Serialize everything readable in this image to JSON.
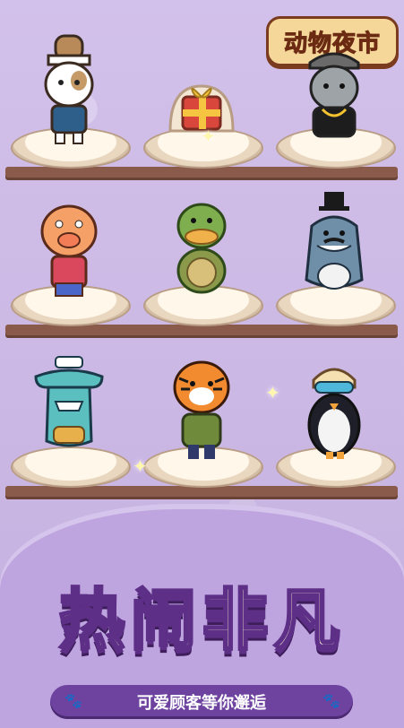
{
  "logo": {
    "text": "动物夜市"
  },
  "banner": {
    "title": "热闹非凡",
    "subtitle": "可爱顾客等你邂逅"
  },
  "icons": {
    "paw_left": "paw-icon",
    "paw_right": "paw-icon",
    "sparkle": "sparkle-icon"
  },
  "colors": {
    "background": "#c9b6e0",
    "shelf": "#8a5a4a",
    "title_fill": "#fff6d6",
    "title_outline": "#5d2f86",
    "subtitle_bar": "#6e43a0"
  },
  "characters": [
    {
      "name": "chef-dog",
      "row": 1,
      "col": 1
    },
    {
      "name": "gift-box",
      "row": 1,
      "col": 2
    },
    {
      "name": "gangster-seal",
      "row": 1,
      "col": 3
    },
    {
      "name": "pig",
      "row": 2,
      "col": 1
    },
    {
      "name": "turtle-duck",
      "row": 2,
      "col": 2
    },
    {
      "name": "gentleman-shark",
      "row": 2,
      "col": 3
    },
    {
      "name": "sailor-hammerhead",
      "row": 3,
      "col": 1
    },
    {
      "name": "tiger",
      "row": 3,
      "col": 2
    },
    {
      "name": "cool-penguin",
      "row": 3,
      "col": 3
    }
  ]
}
